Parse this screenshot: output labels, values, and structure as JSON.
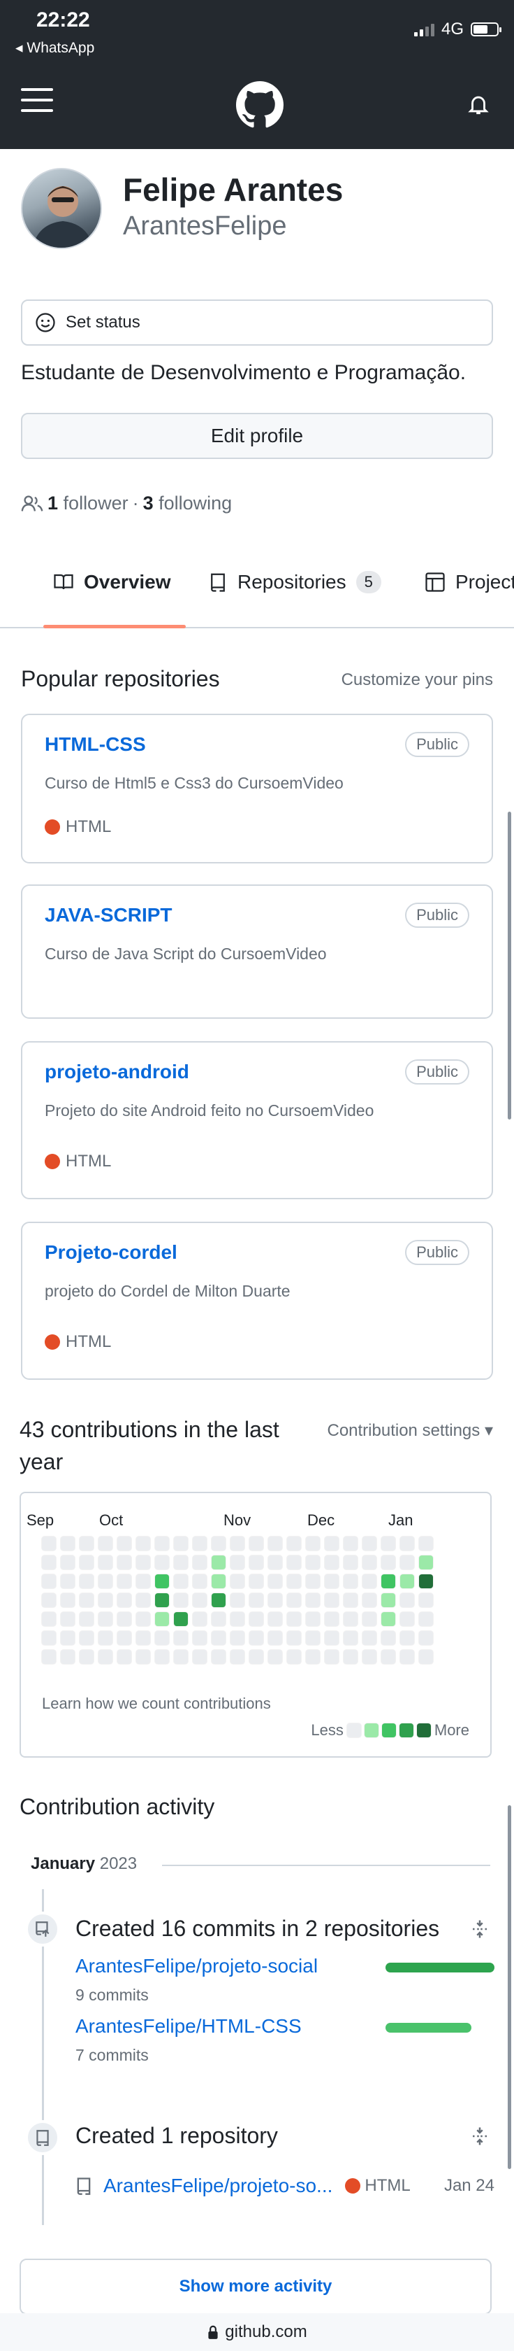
{
  "status_bar": {
    "time": "22:22",
    "back_app": "◂ WhatsApp",
    "network": "4G"
  },
  "header": {
    "logo": "github-logo",
    "menu_icon": "hamburger-icon",
    "bell_icon": "bell-icon"
  },
  "profile": {
    "name": "Felipe Arantes",
    "login": "ArantesFelipe",
    "status_label": "Set status",
    "bio": "Estudante de Desenvolvimento e Programação.",
    "edit_label": "Edit profile",
    "followers_count": "1",
    "followers_label": "follower",
    "separator": "·",
    "following_count": "3",
    "following_label": "following"
  },
  "tabs": [
    {
      "label": "Overview",
      "active": true,
      "icon": "book-icon"
    },
    {
      "label": "Repositories",
      "count": "5",
      "icon": "repo-icon"
    },
    {
      "label": "Projects",
      "icon": "table-icon"
    }
  ],
  "popular": {
    "title": "Popular repositories",
    "customize": "Customize your pins",
    "repos": [
      {
        "name": "HTML-CSS",
        "visibility": "Public",
        "description": "Curso de Html5 e Css3 do CursoemVideo",
        "language": "HTML",
        "lang_color": "#e34c26"
      },
      {
        "name": "JAVA-SCRIPT",
        "visibility": "Public",
        "description": "Curso de Java Script do CursoemVideo"
      },
      {
        "name": "projeto-android",
        "visibility": "Public",
        "description": "Projeto do site Android feito no CursoemVideo",
        "language": "HTML",
        "lang_color": "#e34c26"
      },
      {
        "name": "Projeto-cordel",
        "visibility": "Public",
        "description": "projeto do Cordel de Milton Duarte",
        "language": "HTML",
        "lang_color": "#e34c26"
      }
    ]
  },
  "contributions": {
    "title": "43 contributions in the last year",
    "settings": "Contribution settings ▾",
    "months": [
      "Sep",
      "Oct",
      "Nov",
      "Dec",
      "Jan"
    ],
    "learn": "Learn how we count contributions",
    "legend_less": "Less",
    "legend_more": "More",
    "colors": [
      "#ebedf0",
      "#9be9a8",
      "#40c463",
      "#30a14e",
      "#216e39"
    ],
    "active_cells": [
      {
        "week": 6,
        "day": 2,
        "level": 2
      },
      {
        "week": 6,
        "day": 3,
        "level": 3
      },
      {
        "week": 6,
        "day": 4,
        "level": 1
      },
      {
        "week": 7,
        "day": 4,
        "level": 3
      },
      {
        "week": 9,
        "day": 1,
        "level": 1
      },
      {
        "week": 9,
        "day": 2,
        "level": 1
      },
      {
        "week": 9,
        "day": 3,
        "level": 3
      },
      {
        "week": 18,
        "day": 2,
        "level": 2
      },
      {
        "week": 18,
        "day": 3,
        "level": 1
      },
      {
        "week": 18,
        "day": 4,
        "level": 1
      },
      {
        "week": 19,
        "day": 2,
        "level": 1
      },
      {
        "week": 20,
        "day": 1,
        "level": 1
      },
      {
        "week": 20,
        "day": 2,
        "level": 4
      }
    ],
    "weeks": 21
  },
  "activity": {
    "title": "Contribution activity",
    "month": "January",
    "year": "2023",
    "commits_title": "Created 16 commits in 2 repositories",
    "commit_repos": [
      {
        "name": "ArantesFelipe/projeto-social",
        "commits": "9 commits",
        "fraction": 0.56
      },
      {
        "name": "ArantesFelipe/HTML-CSS",
        "commits": "7 commits",
        "fraction": 0.44
      }
    ],
    "repo_title": "Created 1 repository",
    "new_repo": {
      "name": "ArantesFelipe/projeto-so...",
      "language": "HTML",
      "lang_color": "#e34c26",
      "date": "Jan 24"
    },
    "show_more": "Show more activity"
  },
  "url": "github.com"
}
